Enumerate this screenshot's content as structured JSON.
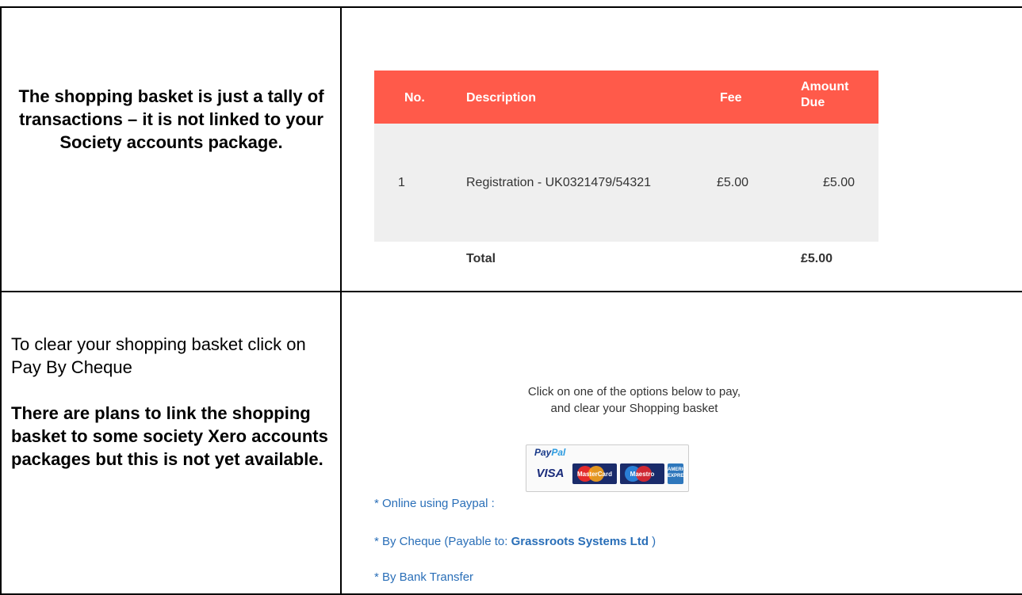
{
  "left_cells": {
    "top_note": "The shopping basket is just a tally of transactions – it is not linked to your Society accounts package.",
    "instruction": "To clear your shopping basket click on Pay By Cheque",
    "plans_note": "There are plans to link the shopping basket to some society Xero accounts packages but this is not yet available."
  },
  "basket": {
    "colors": {
      "header": "#ff5a4a",
      "row": "#efefef"
    },
    "headers": {
      "no": "No.",
      "description": "Description",
      "fee": "Fee",
      "amount_due": "Amount Due"
    },
    "rows": [
      {
        "no": "1",
        "description": "Registration - UK0321479/54321",
        "fee": "£5.00",
        "amount_due": "£5.00"
      }
    ],
    "total_label": "Total",
    "total_due": "£5.00"
  },
  "payment": {
    "intro_line1": "Click on one of the options below to pay,",
    "intro_line2": "and clear your Shopping basket",
    "paypal_badge": {
      "logo_pay": "Pay",
      "logo_pal": "Pal",
      "cards": [
        "VISA",
        "MasterCard",
        "Maestro",
        "AMERICAN EXPRESS"
      ]
    },
    "options": {
      "paypal": "* Online using Paypal :",
      "cheque_prefix": "* By Cheque (Payable to: ",
      "cheque_payee": "Grassroots Systems Ltd",
      "cheque_suffix": " )",
      "bank": "* By Bank Transfer"
    }
  }
}
